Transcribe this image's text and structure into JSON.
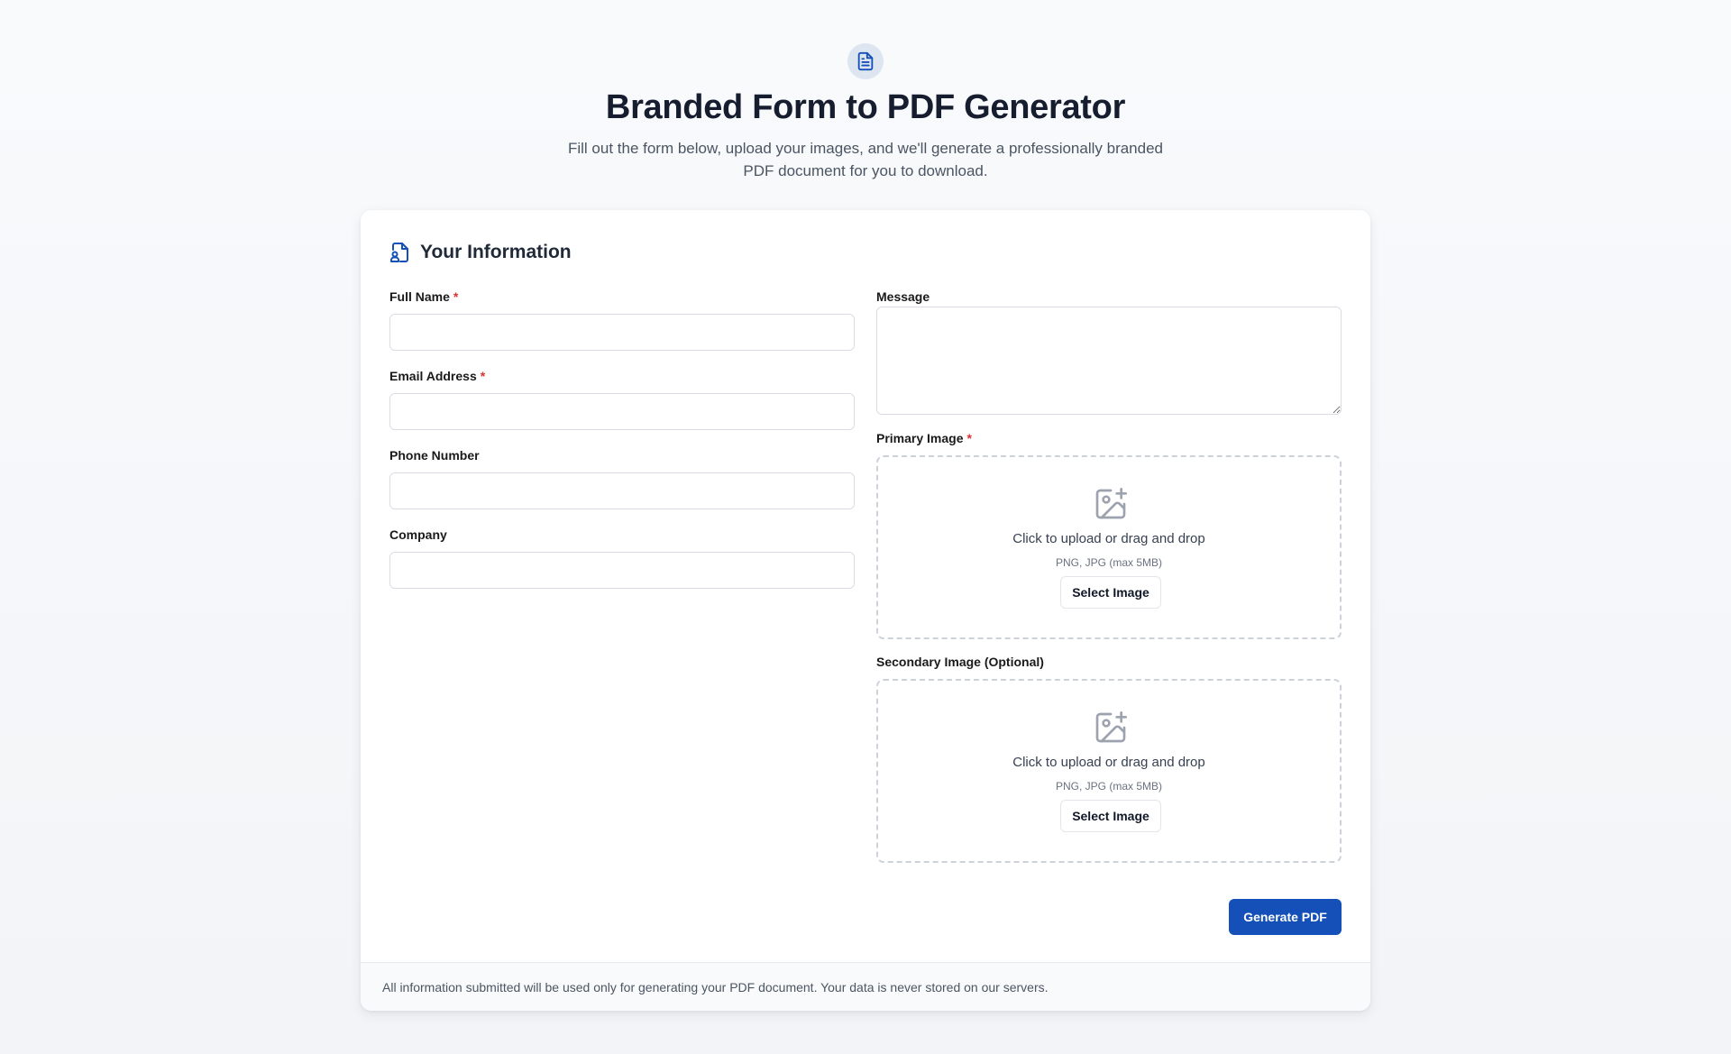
{
  "header": {
    "title": "Branded Form to PDF Generator",
    "subtitle": "Fill out the form below, upload your images, and we'll generate a professionally branded PDF document for you to download.",
    "icon": "document-icon"
  },
  "form": {
    "section_title": "Your Information",
    "section_icon": "file-user-icon",
    "required_marker": "*",
    "fields": {
      "full_name": {
        "label": "Full Name",
        "value": "",
        "placeholder": ""
      },
      "email": {
        "label": "Email Address",
        "value": "",
        "placeholder": ""
      },
      "phone": {
        "label": "Phone Number",
        "value": "",
        "placeholder": ""
      },
      "company": {
        "label": "Company",
        "value": "",
        "placeholder": ""
      },
      "message": {
        "label": "Message",
        "value": "",
        "placeholder": ""
      }
    },
    "primary_image": {
      "label": "Primary Image",
      "prompt": "Click to upload or drag and drop",
      "hint": "PNG, JPG (max 5MB)",
      "button": "Select Image",
      "icon": "image-plus-icon"
    },
    "secondary_image": {
      "label": "Secondary Image (Optional)",
      "prompt": "Click to upload or drag and drop",
      "hint": "PNG, JPG (max 5MB)",
      "button": "Select Image",
      "icon": "image-plus-icon"
    },
    "submit_label": "Generate PDF"
  },
  "footer": {
    "note": "All information submitted will be used only for generating your PDF document. Your data is never stored on our servers."
  },
  "colors": {
    "primary": "#1550b8",
    "required": "#e03131",
    "icon_muted": "#9ca3af"
  }
}
